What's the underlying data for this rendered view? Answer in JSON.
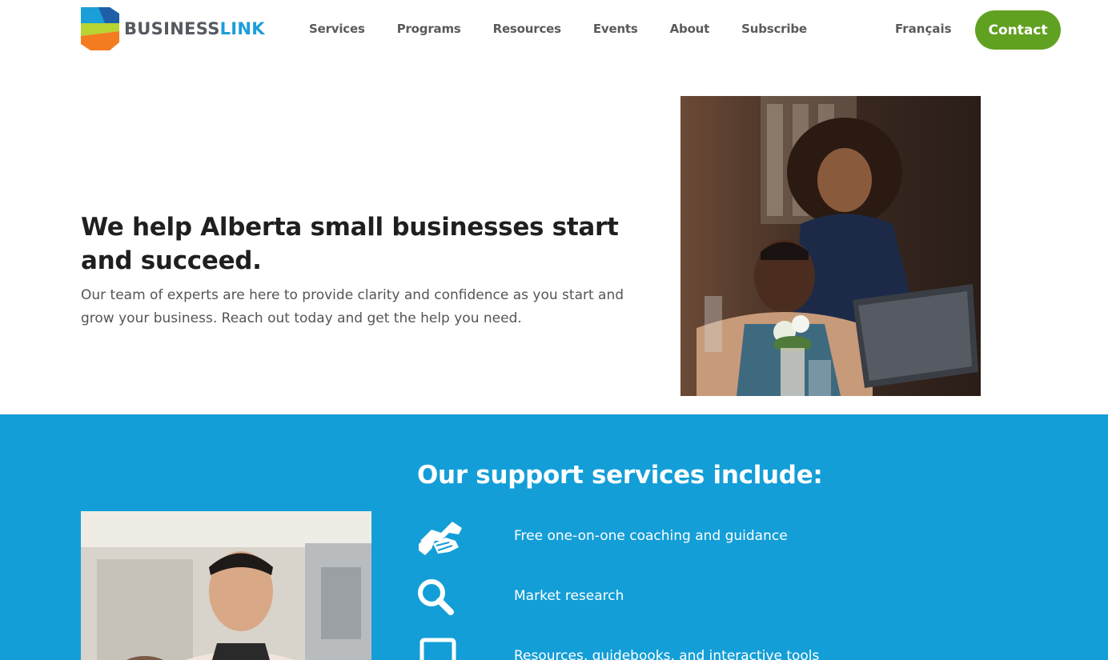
{
  "brand": {
    "name_part1": "BUSINESS",
    "name_part2": "LINK",
    "colors": {
      "blue": "#1a9fd8",
      "green": "#61a121",
      "lime": "#b7d432",
      "orange": "#f47b20",
      "navy": "#1f5fa8"
    }
  },
  "nav": {
    "items": [
      "Services",
      "Programs",
      "Resources",
      "Events",
      "About",
      "Subscribe"
    ],
    "language": "Français",
    "contact": "Contact"
  },
  "hero": {
    "title": "We help Alberta small businesses start and succeed.",
    "subtitle": "Our team of experts are here to provide clarity and confidence as you start and grow your business. Reach out today and get the help you need."
  },
  "services": {
    "title": "Our support services include:",
    "items": [
      {
        "icon": "handshake-icon",
        "label": "Free one-on-one coaching and guidance"
      },
      {
        "icon": "search-icon",
        "label": "Market research"
      },
      {
        "icon": "tablet-icon",
        "label": "Resources, guidebooks, and interactive tools"
      }
    ]
  },
  "theme": {
    "section_bg": "#139ed7",
    "contact_bg": "#61a121"
  }
}
